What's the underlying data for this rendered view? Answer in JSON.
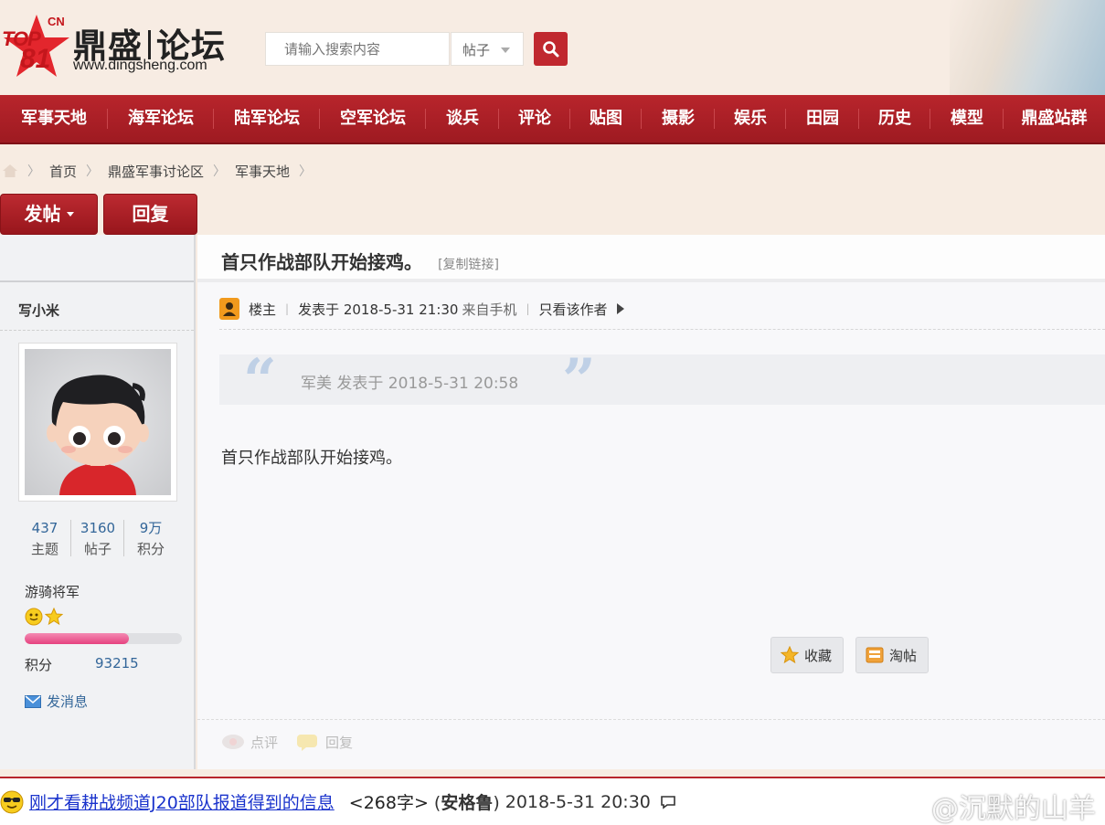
{
  "logo": {
    "cn": "CN",
    "top": "TOP",
    "num": "81",
    "name_left": "鼎盛",
    "name_right": "论坛",
    "url": "www.dingsheng.com"
  },
  "search": {
    "placeholder": "请输入搜索内容",
    "type": "帖子"
  },
  "nav": [
    "军事天地",
    "海军论坛",
    "陆军论坛",
    "空军论坛",
    "谈兵",
    "评论",
    "贴图",
    "摄影",
    "娱乐",
    "田园",
    "历史",
    "模型",
    "鼎盛站群"
  ],
  "breadcrumb": [
    "首页",
    "鼎盛军事讨论区",
    "军事天地"
  ],
  "actions": {
    "post": "发帖",
    "reply": "回复"
  },
  "thread": {
    "title": "首只作战部队开始接鸡。",
    "copy_link": "[复制链接]"
  },
  "user": {
    "name": "写小米",
    "stats": [
      {
        "value": "437",
        "label": "主题"
      },
      {
        "value": "3160",
        "label": "帖子"
      },
      {
        "value": "9万",
        "label": "积分"
      }
    ],
    "rank": "游骑将军",
    "level_progress": 0.66,
    "points_label": "积分",
    "points_value": "93215",
    "send_message": "发消息"
  },
  "post": {
    "floor": "楼主",
    "posted_at": "发表于 2018-5-31 21:30",
    "from": "来自手机",
    "only_author": "只看该作者",
    "quote": "军美 发表于 2018-5-31 20:58",
    "content": "首只作战部队开始接鸡。",
    "favorite": "收藏",
    "tao": "淘帖",
    "comment": "点评",
    "reply": "回复"
  },
  "bottom": {
    "link": "刚才看耕战频道J20部队报道得到的信息",
    "chars": "<268字>",
    "author": "安格鲁",
    "time": "2018-5-31 20:30"
  },
  "watermark": "@沉默的山羊",
  "colors": {
    "brand_red": "#b8252c",
    "link_blue": "#336699",
    "page_bg": "#f7ece2"
  }
}
